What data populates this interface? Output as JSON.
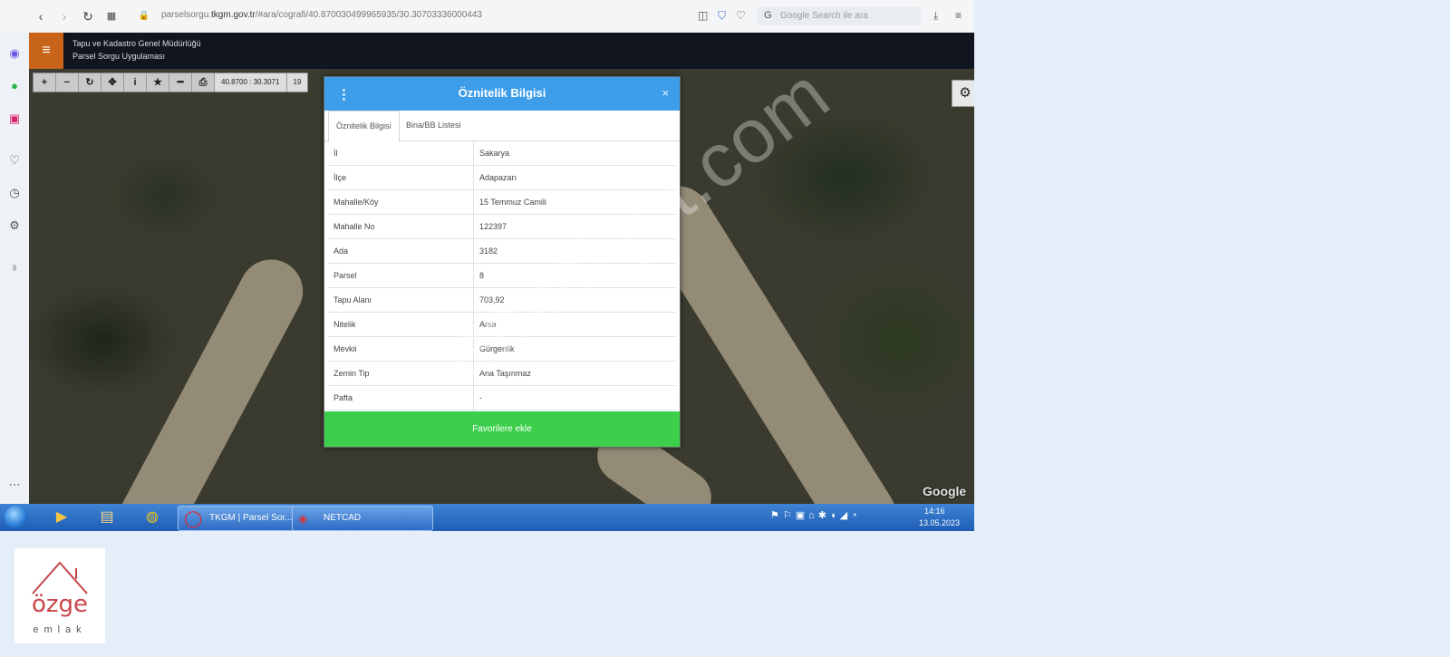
{
  "browser": {
    "url_prefix": "parselsorgu.",
    "url_domain": "tkgm.gov.tr",
    "url_path": "/#ara/cografi/40.870030499965935/30.30703336000443",
    "search_placeholder": "Google Search ile ara"
  },
  "app": {
    "title_line1": "Tapu ve Kadastro Genel Müdürlüğü",
    "title_line2": "Parsel Sorgu Uygulaması"
  },
  "map": {
    "coords": "40.8700 : 30.3071",
    "zoom": "19",
    "google_label": "Google"
  },
  "dialog": {
    "title": "Öznitelik Bilgisi",
    "close": "×",
    "tabs": [
      "Öznitelik Bilgisi",
      "Bina/BB Listesi"
    ],
    "rows": [
      {
        "key": "İl",
        "value": "Sakarya"
      },
      {
        "key": "İlçe",
        "value": "Adapazarı"
      },
      {
        "key": "Mahalle/Köy",
        "value": "15 Temmuz Camili"
      },
      {
        "key": "Mahalle No",
        "value": "122397"
      },
      {
        "key": "Ada",
        "value": "3182"
      },
      {
        "key": "Parsel",
        "value": "8"
      },
      {
        "key": "Tapu Alanı",
        "value": "703,92"
      },
      {
        "key": "Nitelik",
        "value": "Arsa"
      },
      {
        "key": "Mevkii",
        "value": "Gürgenlik"
      },
      {
        "key": "Zemin Tip",
        "value": "Ana Taşınmaz"
      },
      {
        "key": "Pafta",
        "value": "-"
      }
    ],
    "fav_button": "Favorilere ekle"
  },
  "watermark": "emlakjet.com",
  "taskbar": {
    "task1": "TKGM | Parsel Sor...",
    "task2": "NETCAD",
    "time": "14:16",
    "date": "13.05.2023"
  },
  "logo": {
    "brand": "özge",
    "sub": "emlak"
  },
  "colors": {
    "dialog_header": "#3d9de8",
    "fav_button": "#3bcf4b",
    "menu_button": "#c8641a"
  }
}
